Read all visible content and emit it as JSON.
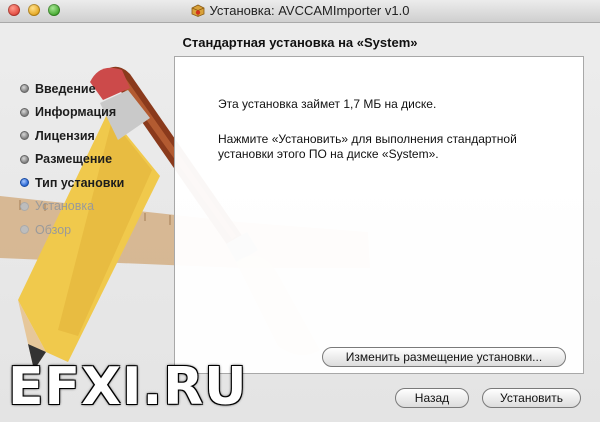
{
  "window": {
    "title": "Установка: AVCCAMImporter v1.0",
    "title_icon": "installer-box-icon"
  },
  "header": {
    "subtitle": "Стандартная установка на «System»"
  },
  "sidebar": {
    "steps": [
      {
        "label": "Введение",
        "state": "done"
      },
      {
        "label": "Информация",
        "state": "done"
      },
      {
        "label": "Лицензия",
        "state": "done"
      },
      {
        "label": "Размещение",
        "state": "done"
      },
      {
        "label": "Тип установки",
        "state": "current"
      },
      {
        "label": "Установка",
        "state": "pending"
      },
      {
        "label": "Обзор",
        "state": "pending"
      }
    ]
  },
  "content": {
    "line1": "Эта установка займет 1,7 МБ на диске.",
    "line2": "Нажмите «Установить» для выполнения стандартной установки этого ПО на диске «System»."
  },
  "buttons": {
    "change_location": "Изменить размещение установки...",
    "back": "Назад",
    "install": "Установить"
  },
  "watermark": "EFXI.RU",
  "colors": {
    "accent": "#1e5fd0",
    "disabled_text": "#9a9a9a"
  }
}
